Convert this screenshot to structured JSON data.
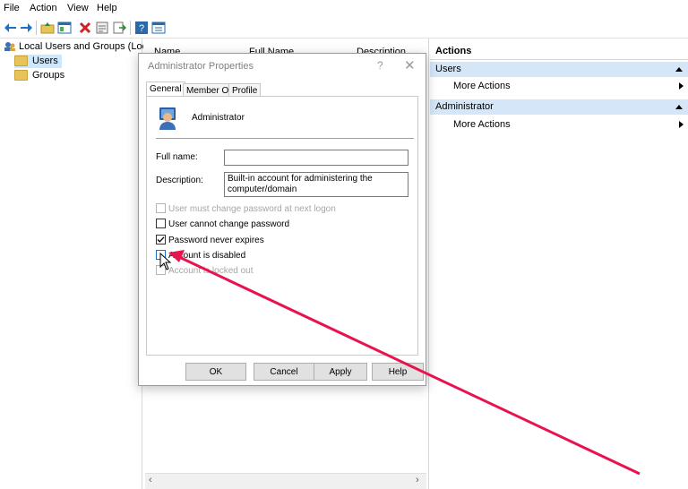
{
  "menu": [
    "File",
    "Action",
    "View",
    "Help"
  ],
  "toolbar_icons": [
    "back-arrow-icon",
    "forward-arrow-icon",
    "up-folder-icon",
    "show-hide-tree-icon",
    "delete-icon",
    "properties-icon",
    "export-icon",
    "help-icon",
    "view-icon"
  ],
  "tree": {
    "root": "Local Users and Groups (Local)",
    "items": [
      "Users",
      "Groups"
    ]
  },
  "list": {
    "columns": [
      "Name",
      "Full Name",
      "Description"
    ]
  },
  "actions": {
    "title": "Actions",
    "sections": [
      {
        "header": "Users",
        "item": "More Actions"
      },
      {
        "header": "Administrator",
        "item": "More Actions"
      }
    ]
  },
  "dialog": {
    "title": "Administrator Properties",
    "help": "?",
    "close": "✕",
    "tabs": [
      "General",
      "Member Of",
      "Profile"
    ],
    "username": "Administrator",
    "full_name_label": "Full name:",
    "full_name_value": "",
    "description_label": "Description:",
    "description_value": "Built-in account for administering the computer/domain",
    "checkboxes": [
      {
        "label": "User must change password at next logon",
        "checked": false,
        "disabled": true
      },
      {
        "label": "User cannot change password",
        "checked": false,
        "disabled": false
      },
      {
        "label": "Password never expires",
        "checked": true,
        "disabled": false
      },
      {
        "label": "Account is disabled",
        "checked": false,
        "disabled": false
      },
      {
        "label": "Account is locked out",
        "checked": false,
        "disabled": true
      }
    ],
    "buttons": [
      "OK",
      "Cancel",
      "Apply",
      "Help"
    ]
  },
  "colors": {
    "action_header_bg": "#3c7fc1",
    "annotation_arrow": "#e8134e",
    "selected_tree_bg": "#cce8ff"
  }
}
